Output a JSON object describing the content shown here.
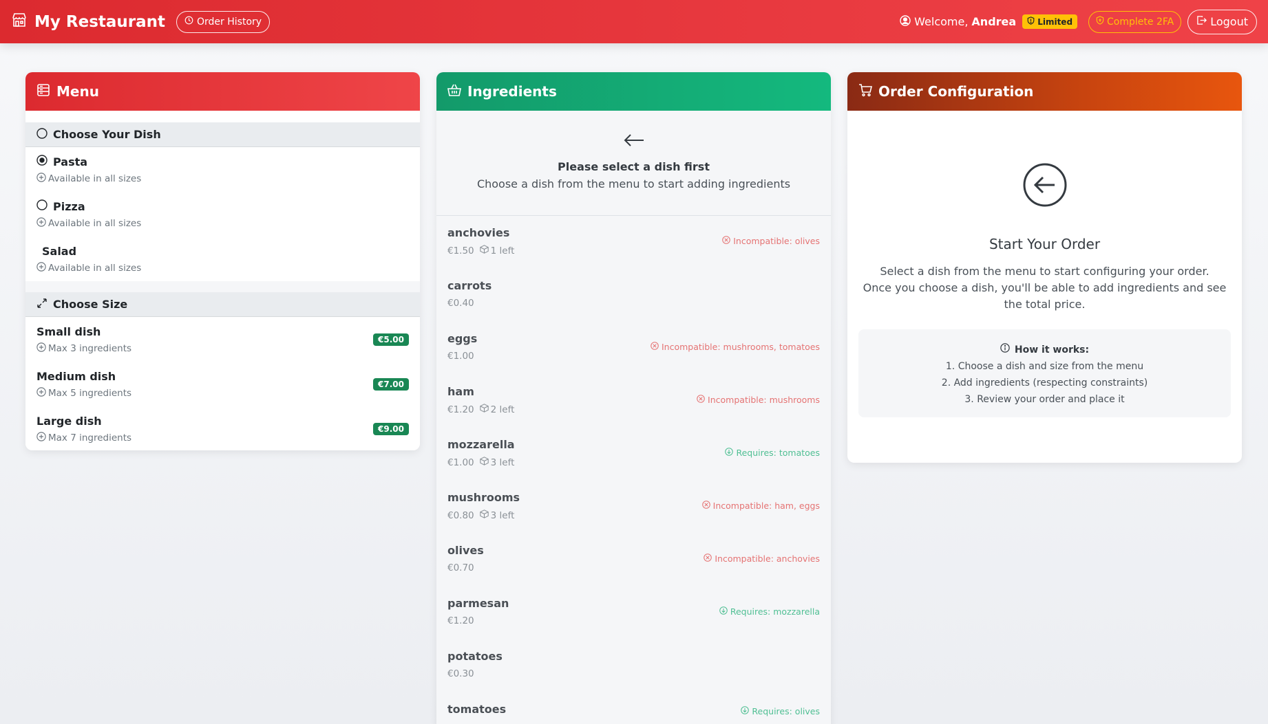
{
  "navbar": {
    "brand": "My Restaurant",
    "order_history": "Order History",
    "welcome_prefix": "Welcome,",
    "username": "Andrea",
    "limited_badge": "Limited",
    "complete_2fa": "Complete 2FA",
    "logout": "Logout",
    "accent_color": "#dc2a2f"
  },
  "menu": {
    "title": "Menu",
    "dish_section": "Choose Your Dish",
    "dishes": [
      {
        "name": "Pasta",
        "note": "Available in all sizes",
        "selected": true
      },
      {
        "name": "Pizza",
        "note": "Available in all sizes",
        "selected": false
      },
      {
        "name": "Salad",
        "note": "Available in all sizes",
        "selected": false
      }
    ],
    "size_section": "Choose Size",
    "sizes": [
      {
        "name": "Small dish",
        "note": "Max 3 ingredients",
        "price": "€5.00"
      },
      {
        "name": "Medium dish",
        "note": "Max 5 ingredients",
        "price": "€7.00"
      },
      {
        "name": "Large dish",
        "note": "Max 7 ingredients",
        "price": "€9.00"
      }
    ]
  },
  "ingredients": {
    "title": "Ingredients",
    "placeholder_title": "Please select a dish first",
    "placeholder_sub": "Choose a dish from the menu to start adding ingredients",
    "items": [
      {
        "name": "anchovies",
        "price": "€1.50",
        "stock": "1 left",
        "constraint": "Incompatible: olives",
        "type": "bad"
      },
      {
        "name": "carrots",
        "price": "€0.40",
        "stock": "",
        "constraint": "",
        "type": ""
      },
      {
        "name": "eggs",
        "price": "€1.00",
        "stock": "",
        "constraint": "Incompatible: mushrooms, tomatoes",
        "type": "bad"
      },
      {
        "name": "ham",
        "price": "€1.20",
        "stock": "2 left",
        "constraint": "Incompatible: mushrooms",
        "type": "bad"
      },
      {
        "name": "mozzarella",
        "price": "€1.00",
        "stock": "3 left",
        "constraint": "Requires: tomatoes",
        "type": "good"
      },
      {
        "name": "mushrooms",
        "price": "€0.80",
        "stock": "3 left",
        "constraint": "Incompatible: ham, eggs",
        "type": "bad"
      },
      {
        "name": "olives",
        "price": "€0.70",
        "stock": "",
        "constraint": "Incompatible: anchovies",
        "type": "bad"
      },
      {
        "name": "parmesan",
        "price": "€1.20",
        "stock": "",
        "constraint": "Requires: mozzarella",
        "type": "good"
      },
      {
        "name": "potatoes",
        "price": "€0.30",
        "stock": "",
        "constraint": "",
        "type": ""
      },
      {
        "name": "tomatoes",
        "price": "",
        "stock": "",
        "constraint": "Requires: olives",
        "type": "good"
      }
    ]
  },
  "order": {
    "title": "Order Configuration",
    "start_title": "Start Your Order",
    "desc_line1": "Select a dish from the menu to start configuring your order.",
    "desc_line2": "Once you choose a dish, you'll be able to add ingredients and see the total price.",
    "how_title": "How it works:",
    "steps": [
      "1. Choose a dish and size from the menu",
      "2. Add ingredients (respecting constraints)",
      "3. Review your order and place it"
    ]
  }
}
